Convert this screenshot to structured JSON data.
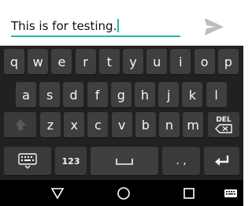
{
  "compose": {
    "message_text": "This is for testing.",
    "send_icon": "send-icon"
  },
  "keyboard": {
    "row1": [
      "q",
      "w",
      "e",
      "r",
      "t",
      "y",
      "u",
      "i",
      "o",
      "p"
    ],
    "row2": [
      "a",
      "s",
      "d",
      "f",
      "g",
      "h",
      "j",
      "k",
      "l"
    ],
    "row3": [
      "z",
      "x",
      "c",
      "v",
      "b",
      "n",
      "m"
    ],
    "delete_label": "DEL",
    "numbers_label": "123",
    "period_comma_label": ". ,",
    "icons": [
      "keyboard-settings-icon",
      "shift-icon",
      "backspace-icon",
      "space-icon",
      "enter-icon"
    ]
  },
  "navbar": {
    "icons": [
      "back-icon",
      "home-icon",
      "recents-icon",
      "keyboard-switch-icon"
    ]
  },
  "colors": {
    "accent": "#2bb3a6",
    "keyboard_bg": "#212121",
    "key_bg": "#3f3f3f"
  }
}
